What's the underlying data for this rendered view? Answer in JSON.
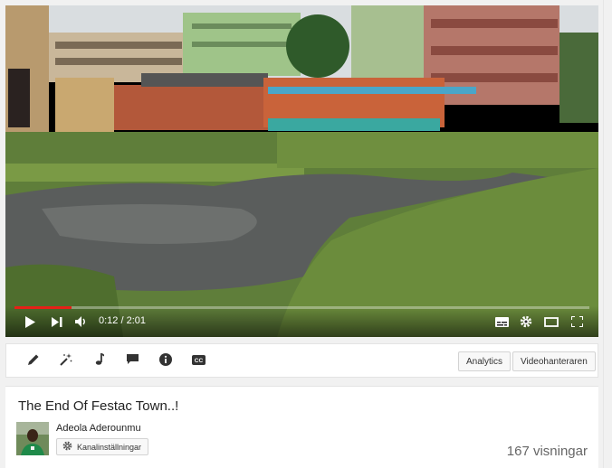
{
  "player": {
    "time_current": "0:12",
    "time_total": "2:01",
    "time_display": "0:12 / 2:01",
    "progress_fraction": 0.099,
    "accent_color": "#e62117"
  },
  "toolbar": {
    "icons": [
      "pencil-icon",
      "magic-wand-icon",
      "music-note-icon",
      "speech-bubble-icon",
      "info-icon",
      "cc-icon"
    ],
    "analytics_label": "Analytics",
    "videomanager_label": "Videohanteraren"
  },
  "video": {
    "title": "The End Of Festac Town..!",
    "channel_name": "Adeola Aderounmu",
    "channel_settings_label": "Kanalinställningar",
    "views": "167 visningar"
  }
}
